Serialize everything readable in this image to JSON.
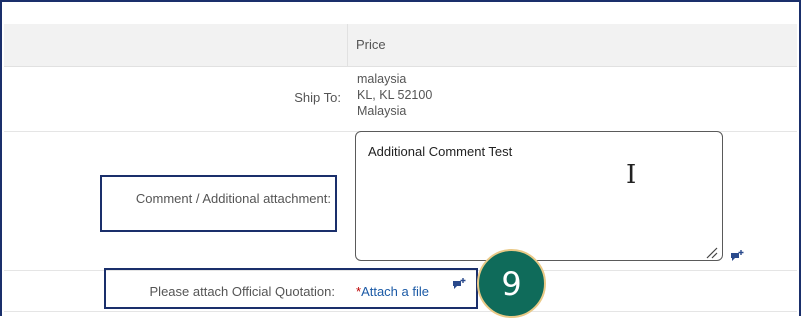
{
  "header": {
    "price_label": "Price"
  },
  "ship_to": {
    "label": "Ship To:",
    "lines": [
      "malaysia",
      "KL, KL 52100",
      "Malaysia"
    ]
  },
  "comment": {
    "label": "Comment / Additional attachment:",
    "value": "Additional Comment Test",
    "text_cursor_glyph": "I"
  },
  "quotation": {
    "label": "Please attach Official Quotation:",
    "required_marker": "*",
    "attach_link": "Attach a file"
  },
  "step_badge": {
    "number": "9",
    "color": "#0f6b5a",
    "border": "#e9c987"
  },
  "colors": {
    "highlight": "#1a2f6b",
    "link": "#1b5aa6",
    "required": "#bb0000"
  },
  "icons": [
    "comment-add-icon",
    "resize-handle-icon"
  ]
}
